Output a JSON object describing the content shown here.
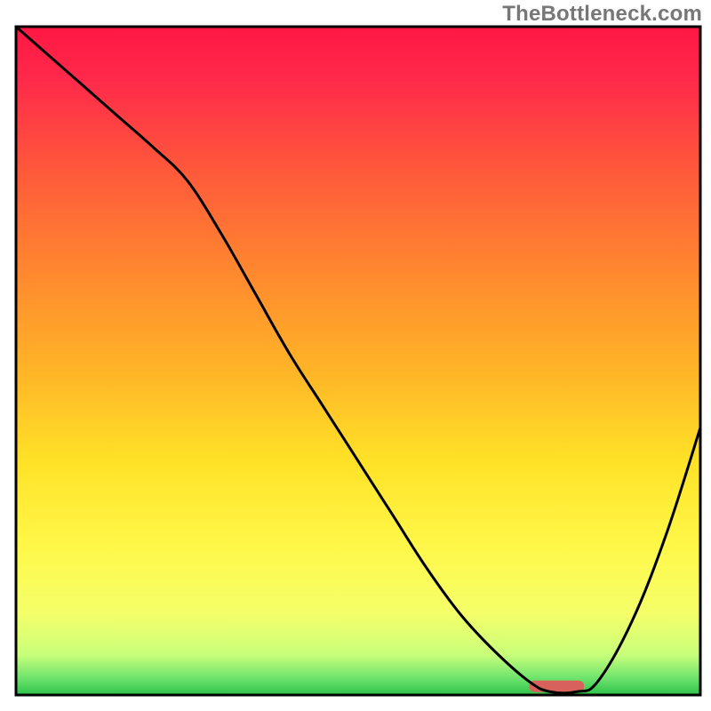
{
  "watermark": "TheBottleneck.com",
  "chart_data": {
    "type": "line",
    "title": "",
    "xlabel": "",
    "ylabel": "",
    "xlim": [
      0,
      100
    ],
    "ylim": [
      0,
      100
    ],
    "x": [
      0,
      5,
      10,
      15,
      20,
      25,
      30,
      35,
      40,
      45,
      50,
      55,
      60,
      65,
      70,
      75,
      78,
      82,
      85,
      90,
      95,
      100
    ],
    "values": [
      100,
      95.5,
      91,
      86.5,
      82,
      77,
      69,
      60,
      51,
      43,
      35,
      27,
      19,
      12,
      6.5,
      2,
      0.5,
      0.5,
      2,
      11,
      24,
      40
    ],
    "marker": {
      "x_start": 75,
      "x_end": 83,
      "y": 1.3
    },
    "gradient_stops": [
      {
        "offset": 0.0,
        "color": "#ff1744"
      },
      {
        "offset": 0.08,
        "color": "#ff2a4a"
      },
      {
        "offset": 0.22,
        "color": "#ff5a3a"
      },
      {
        "offset": 0.38,
        "color": "#ff8c2e"
      },
      {
        "offset": 0.52,
        "color": "#ffb627"
      },
      {
        "offset": 0.65,
        "color": "#ffe227"
      },
      {
        "offset": 0.78,
        "color": "#fff84a"
      },
      {
        "offset": 0.88,
        "color": "#f4ff6a"
      },
      {
        "offset": 0.94,
        "color": "#c8ff7a"
      },
      {
        "offset": 0.975,
        "color": "#6de36d"
      },
      {
        "offset": 1.0,
        "color": "#2ec24a"
      }
    ],
    "marker_color": "#d9615b",
    "line_color": "#000000",
    "frame_color": "#000000"
  }
}
